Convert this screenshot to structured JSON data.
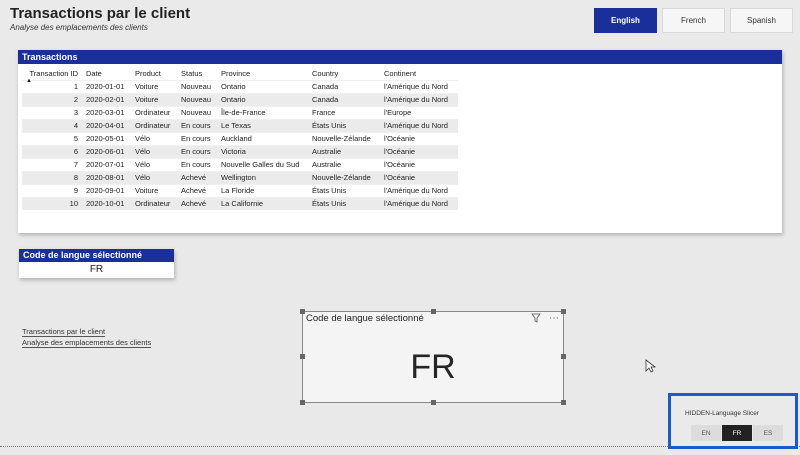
{
  "header": {
    "title": "Transactions par le client",
    "subtitle": "Analyse des emplacements des clients"
  },
  "language_buttons": [
    {
      "label": "English",
      "active": true
    },
    {
      "label": "French",
      "active": false
    },
    {
      "label": "Spanish",
      "active": false
    }
  ],
  "transactions": {
    "title": "Transactions",
    "columns": [
      "Transaction ID",
      "Date",
      "Product",
      "Status",
      "Province",
      "Country",
      "Continent"
    ],
    "rows": [
      [
        "1",
        "2020-01-01",
        "Voiture",
        "Nouveau",
        "Ontario",
        "Canada",
        "l'Amérique du Nord"
      ],
      [
        "2",
        "2020-02-01",
        "Voiture",
        "Nouveau",
        "Ontario",
        "Canada",
        "l'Amérique du Nord"
      ],
      [
        "3",
        "2020-03-01",
        "Ordinateur",
        "Nouveau",
        "Île-de-France",
        "France",
        "l'Europe"
      ],
      [
        "4",
        "2020-04-01",
        "Ordinateur",
        "En cours",
        "Le Texas",
        "États Unis",
        "l'Amérique du Nord"
      ],
      [
        "5",
        "2020-05-01",
        "Vélo",
        "En cours",
        "Auckland",
        "Nouvelle-Zélande",
        "l'Océanie"
      ],
      [
        "6",
        "2020-06-01",
        "Vélo",
        "En cours",
        "Victoria",
        "Australie",
        "l'Océanie"
      ],
      [
        "7",
        "2020-07-01",
        "Vélo",
        "En cours",
        "Nouvelle Galles du Sud",
        "Australie",
        "l'Océanie"
      ],
      [
        "8",
        "2020-08-01",
        "Vélo",
        "Achevé",
        "Wellington",
        "Nouvelle-Zélande",
        "l'Océanie"
      ],
      [
        "9",
        "2020-09-01",
        "Voiture",
        "Achevé",
        "La Floride",
        "États Unis",
        "l'Amérique du Nord"
      ],
      [
        "10",
        "2020-10-01",
        "Ordinateur",
        "Achevé",
        "La Californie",
        "États Unis",
        "l'Amérique du Nord"
      ]
    ]
  },
  "code_table": {
    "title": "Code de langue sélectionné",
    "value": "FR"
  },
  "footer_texts": {
    "line1": "Transactions par le client",
    "line2": "Analyse des emplacements des clients"
  },
  "card_visual": {
    "title": "Code de langue sélectionné",
    "value": "FR",
    "filter_icon": "filter-icon",
    "more_icon": "more-options-icon"
  },
  "hidden_slicer": {
    "label": "HIDDEN-Language Slicer",
    "options": [
      {
        "label": "EN",
        "active": false
      },
      {
        "label": "FR",
        "active": true
      },
      {
        "label": "ES",
        "active": false
      }
    ]
  },
  "colors": {
    "accent": "#1a2f9a",
    "highlight_border": "#1a5bc7"
  }
}
